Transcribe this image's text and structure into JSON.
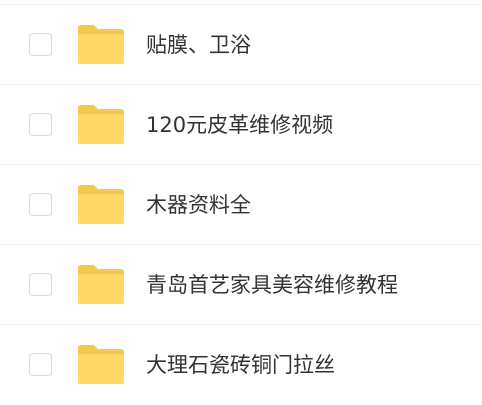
{
  "colors": {
    "folder_tab": "#f5c94b",
    "folder_body": "#ffd866",
    "text": "#333333",
    "checkbox_border": "#d9dbe1",
    "divider": "#f2f2f4"
  },
  "file_list": {
    "items": [
      {
        "name": "贴膜、卫浴",
        "icon": "folder-icon",
        "checked": false
      },
      {
        "name": "120元皮革维修视频",
        "icon": "folder-icon",
        "checked": false
      },
      {
        "name": "木器资料全",
        "icon": "folder-icon",
        "checked": false
      },
      {
        "name": "青岛首艺家具美容维修教程",
        "icon": "folder-icon",
        "checked": false
      },
      {
        "name": "大理石瓷砖铜门拉丝",
        "icon": "folder-icon",
        "checked": false
      }
    ]
  }
}
